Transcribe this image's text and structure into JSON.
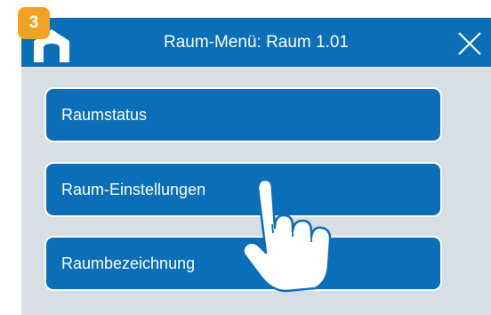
{
  "step": {
    "number": "3"
  },
  "header": {
    "title": "Raum-Menü: Raum 1.01"
  },
  "menu": {
    "items": [
      {
        "label": "Raumstatus"
      },
      {
        "label": "Raum-Einstellungen"
      },
      {
        "label": "Raumbezeichnung"
      }
    ]
  },
  "icons": {
    "home": "home-icon",
    "close": "close-icon",
    "hand": "pointing-hand-icon"
  },
  "colors": {
    "accent": "#0a6eb8",
    "background": "#d8dfe4",
    "badge": "#f2a222"
  }
}
